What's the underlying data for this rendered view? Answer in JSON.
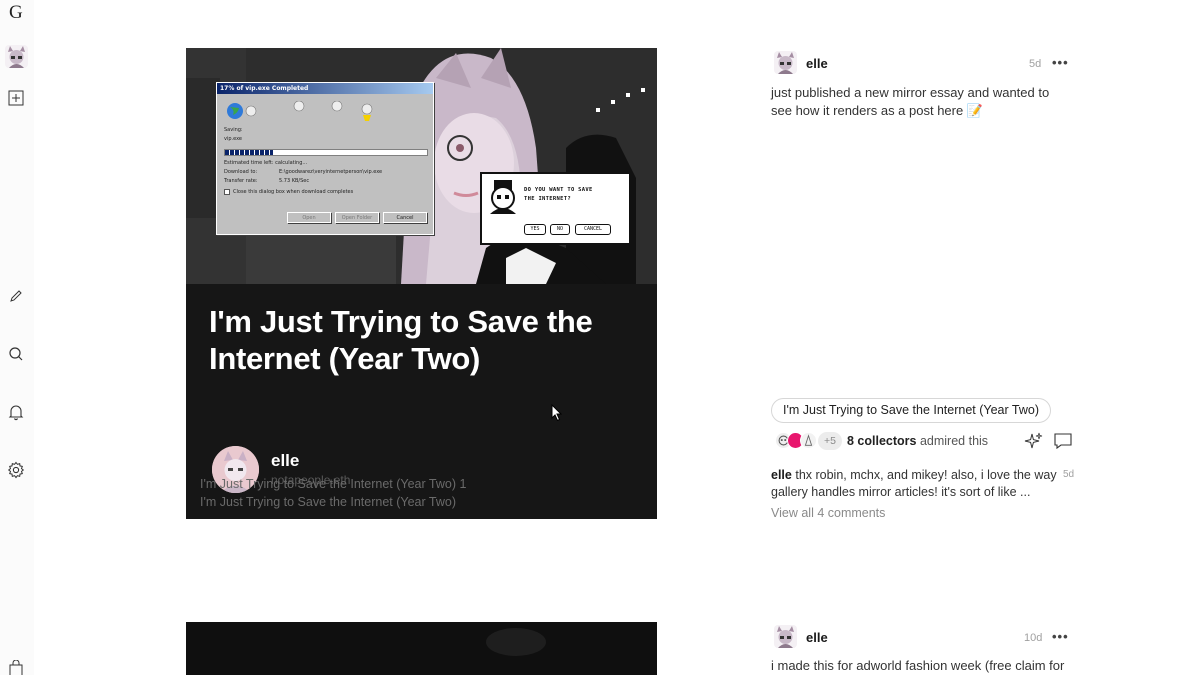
{
  "sidebar": {
    "logo": "G",
    "icons": [
      "plus-square-icon",
      "pencil-icon",
      "search-icon",
      "bell-icon",
      "gear-icon",
      "bag-icon"
    ]
  },
  "post": {
    "title": "I'm Just Trying to Save the Internet (Year Two)",
    "author": {
      "name": "elle",
      "handle": "notapeople.eth"
    },
    "overlay_lines": [
      "I'm Just Trying to Save the Internet (Year Two) 1",
      "I'm Just Trying to Save the Internet (Year Two)"
    ],
    "art": {
      "dialog": {
        "title": "17% of vip.exe Completed",
        "saving_label": "Saving:",
        "file": "vip.exe",
        "est_time": "Estimated time left:  calculating...",
        "download_to": "Download to:",
        "download_path": "E:\\goodwarez\\veryinternetperson\\vip.exe",
        "transfer_rate_label": "Transfer rate:",
        "transfer_rate": "5.73 KB/Sec",
        "checkbox_label": "Close this dialog box when download completes",
        "progress": 0.17,
        "buttons": [
          "Open",
          "Open Folder",
          "Cancel"
        ]
      },
      "pixel_dialog": {
        "question_line1": "DO YOU WANT TO SAVE",
        "question_line2": "THE INTERNET?",
        "buttons": [
          "YES",
          "NO",
          "CANCEL"
        ]
      }
    }
  },
  "sidepost1": {
    "username": "elle",
    "ago": "5d",
    "more": "•••",
    "caption": "just published a new mirror essay and wanted to see how it renders as a post here 📝",
    "pill": "I'm Just Trying to Save the Internet (Year Two)",
    "collectors_extra": "+5",
    "collectors_count": "8 collectors",
    "collectors_suffix": "admired this",
    "comment": {
      "author": "elle",
      "text": "thx robin, mchx, and mikey! also, i love the way gallery handles mirror articles! it's sort of like ...",
      "ago": "5d"
    },
    "view_all": "View all 4 comments"
  },
  "sidepost2": {
    "username": "elle",
    "ago": "10d",
    "more": "•••",
    "caption": "i made this for adworld fashion week (free claim for"
  },
  "colors": {
    "accent_pink": "#e8176e",
    "card_bg": "#161616",
    "muted": "#a0a0a0"
  }
}
